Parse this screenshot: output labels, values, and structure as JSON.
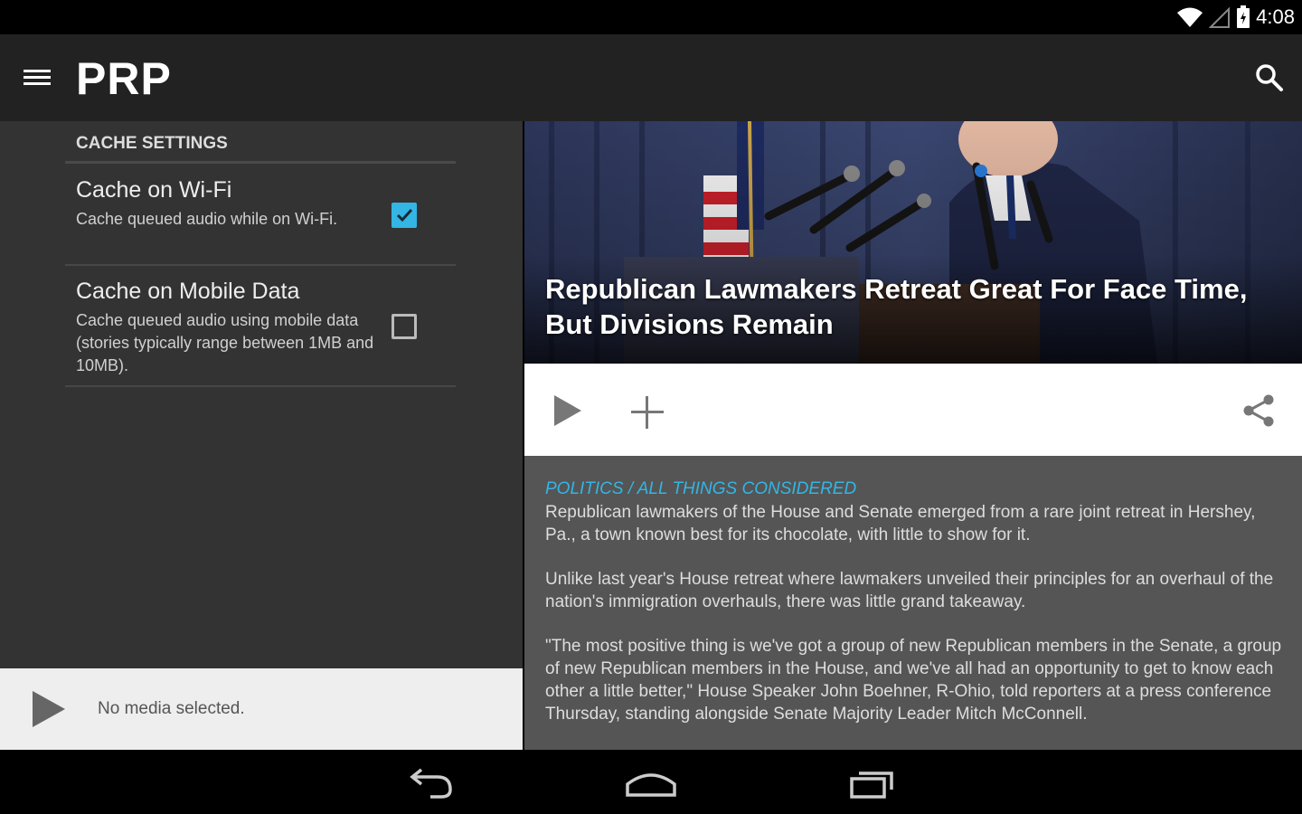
{
  "status_bar": {
    "time": "4:08",
    "icons": [
      "wifi-icon",
      "signal-icon",
      "battery-icon"
    ]
  },
  "app_bar": {
    "title": "PRP",
    "menu_icon": "hamburger-menu-icon",
    "search_icon": "search-icon"
  },
  "settings": {
    "section_header": "CACHE SETTINGS",
    "items": [
      {
        "title": "Cache on Wi-Fi",
        "summary": "Cache queued audio while on Wi-Fi.",
        "checked": true
      },
      {
        "title": "Cache on Mobile Data",
        "summary": "Cache queued audio using mobile data (stories typically range between 1MB and 10MB).",
        "checked": false
      }
    ]
  },
  "mini_player": {
    "status": "No media selected.",
    "play_icon": "play-icon"
  },
  "story": {
    "headline": "Republican Lawmakers Retreat Great For Face Time, But Divisions Remain",
    "actions": {
      "play_icon": "play-icon",
      "add_icon": "add-icon",
      "share_icon": "share-icon"
    },
    "category": "POLITICS / ALL THINGS CONSIDERED",
    "paragraphs": [
      "Republican lawmakers of the House and Senate emerged from a rare joint retreat in Hershey, Pa., a town known best for its chocolate, with little to show for it.",
      "Unlike last year's House retreat where lawmakers unveiled their principles for an overhaul of the nation's immigration overhauls, there was little grand takeaway.",
      "\"The most positive thing is we've got a group of new Republican members in the Senate, a group of new Republican members in the House, and we've all had an opportunity to get to know each other a little better,\" House Speaker John Boehner, R-Ohio, told reporters at a press conference Thursday, standing alongside Senate Majority Leader Mitch McConnell."
    ]
  },
  "colors": {
    "accent": "#33b5e5",
    "app_bar": "#222222",
    "settings_bg": "#333333",
    "story_bg": "#555555"
  },
  "nav_bar": {
    "icons": [
      "back-icon",
      "home-icon",
      "recents-icon"
    ]
  }
}
